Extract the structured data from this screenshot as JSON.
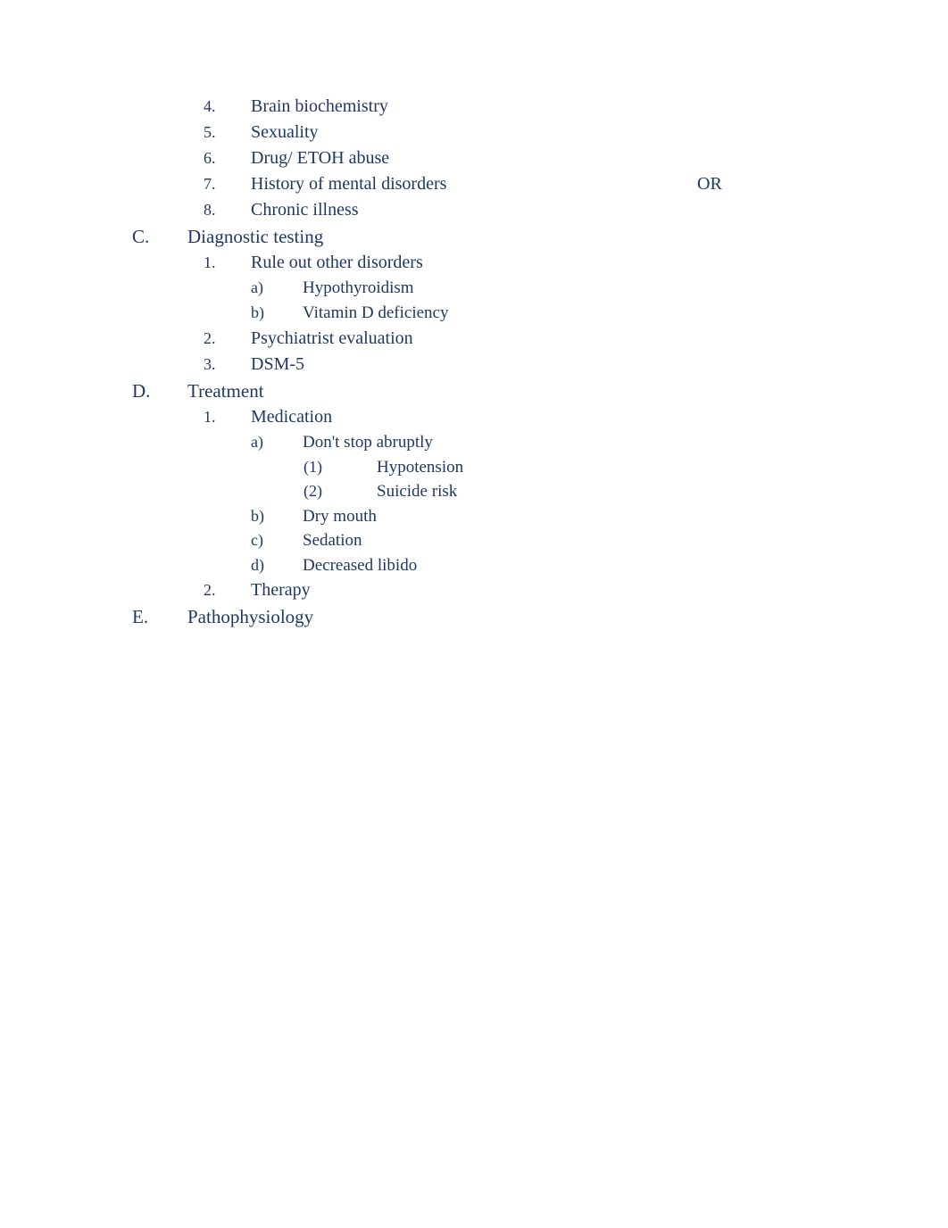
{
  "items": {
    "i4": {
      "marker": "4.",
      "text": "Brain biochemistry"
    },
    "i5": {
      "marker": "5.",
      "text": "Sexuality"
    },
    "i6": {
      "marker": "6.",
      "text": "Drug/ ETOH abuse"
    },
    "i7": {
      "marker": "7.",
      "text": "History of mental disorders",
      "side": "OR"
    },
    "i8": {
      "marker": "8.",
      "text": "Chronic illness"
    }
  },
  "C": {
    "marker": "C.",
    "text": "Diagnostic testing",
    "c1": {
      "marker": "1.",
      "text": "Rule out other disorders",
      "a": {
        "marker": "a)",
        "text": "Hypothyroidism"
      },
      "b": {
        "marker": "b)",
        "text": "Vitamin D deficiency"
      }
    },
    "c2": {
      "marker": "2.",
      "text": "Psychiatrist evaluation"
    },
    "c3": {
      "marker": "3.",
      "text": "DSM-5"
    }
  },
  "D": {
    "marker": "D.",
    "text": "Treatment",
    "d1": {
      "marker": "1.",
      "text": "Medication",
      "a": {
        "marker": "a)",
        "text": "Don't stop abruptly",
        "one": {
          "marker": "(1)",
          "text": "Hypotension"
        },
        "two": {
          "marker": "(2)",
          "text": "Suicide risk"
        }
      },
      "b": {
        "marker": "b)",
        "text": "Dry mouth"
      },
      "c": {
        "marker": "c)",
        "text": "Sedation"
      },
      "d": {
        "marker": "d)",
        "text": "Decreased libido"
      }
    },
    "d2": {
      "marker": "2.",
      "text": "Therapy"
    }
  },
  "E": {
    "marker": "E.",
    "text": "Pathophysiology"
  }
}
